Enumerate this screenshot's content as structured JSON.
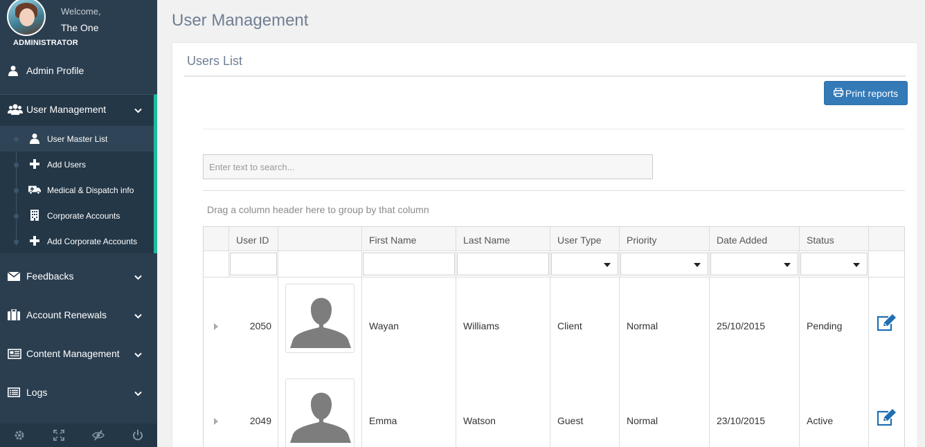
{
  "sidebar": {
    "welcome": "Welcome,",
    "user_name": "The One",
    "role": "ADMINISTRATOR",
    "admin_profile": "Admin Profile",
    "user_management": "User Management",
    "sub_items": [
      {
        "label": "User Master List",
        "icon": "user-icon"
      },
      {
        "label": "Add Users",
        "icon": "plus-icon"
      },
      {
        "label": "Medical & Dispatch info",
        "icon": "ambulance-icon"
      },
      {
        "label": "Corporate Accounts",
        "icon": "building-icon"
      },
      {
        "label": "Add Corporate Accounts",
        "icon": "plus-icon"
      }
    ],
    "feedbacks": "Feedbacks",
    "account_renewals": "Account Renewals",
    "content_management": "Content Management",
    "logs": "Logs",
    "footer_icons": [
      "gear-icon",
      "fullscreen-icon",
      "eye-slash-icon",
      "power-icon"
    ]
  },
  "main": {
    "page_title": "User Management",
    "panel_title": "Users List",
    "print_button": "Print reports",
    "search_placeholder": "Enter text to search...",
    "group_hint": "Drag a column header here to group by that column"
  },
  "grid": {
    "columns": [
      "User ID",
      "",
      "First Name",
      "Last Name",
      "User Type",
      "Priority",
      "Date Added",
      "Status"
    ],
    "rows": [
      {
        "user_id": "2050",
        "first_name": "Wayan",
        "last_name": "Williams",
        "user_type": "Client",
        "priority": "Normal",
        "date_added": "25/10/2015",
        "status": "Pending"
      },
      {
        "user_id": "2049",
        "first_name": "Emma",
        "last_name": "Watson",
        "user_type": "Guest",
        "priority": "Normal",
        "date_added": "23/10/2015",
        "status": "Active"
      }
    ]
  },
  "colors": {
    "sidebar_bg": "#2b3e50",
    "accent": "#1abc9c",
    "primary_button": "#337ab7",
    "edit_icon": "#1f6fb2"
  }
}
